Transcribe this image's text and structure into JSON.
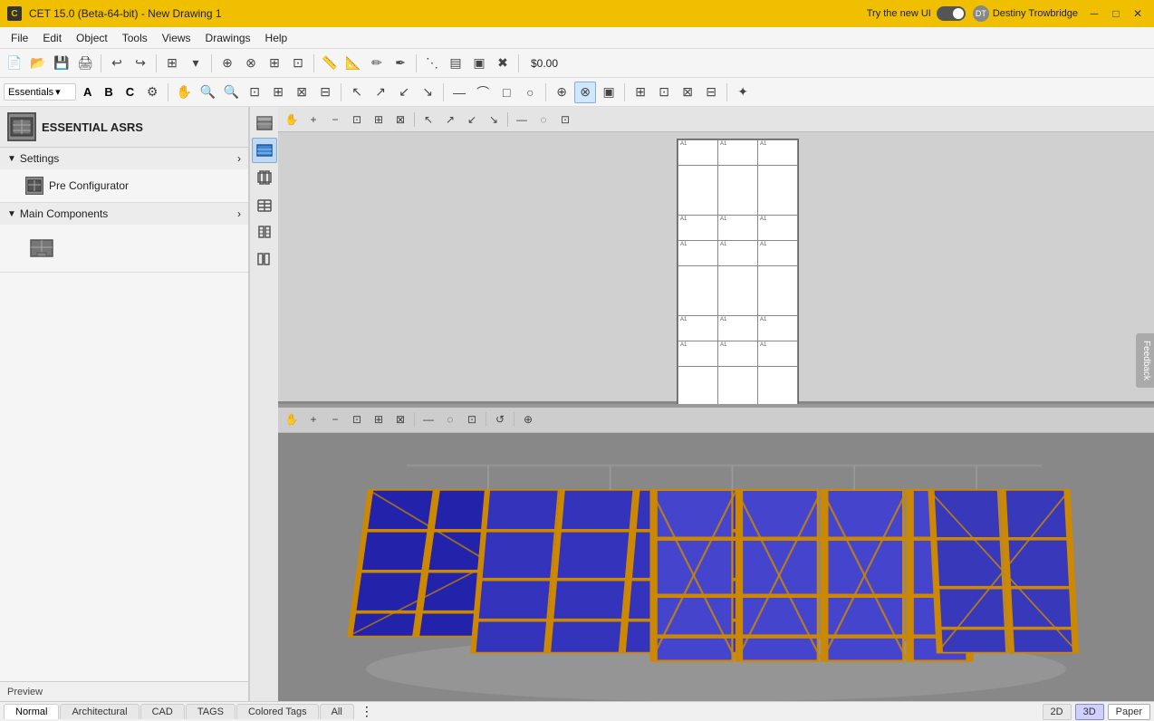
{
  "titleBar": {
    "appTitle": "CET 15.0 (Beta-64-bit) - New Drawing 1",
    "tryNewLabel": "Try the new UI",
    "userName": "Destiny Trowbridge",
    "winMinimize": "─",
    "winMaximize": "□",
    "winClose": "✕"
  },
  "menuBar": {
    "items": [
      "File",
      "Edit",
      "Object",
      "Tools",
      "Views",
      "Drawings",
      "Help"
    ]
  },
  "toolbar1": {
    "buttons": [
      "📋",
      "📂",
      "💾",
      "🖨",
      "|",
      "↩",
      "↪",
      "|",
      "⊞",
      "▾",
      "|"
    ],
    "price": "$0.00"
  },
  "workspaceTabs": {
    "tabs": [
      "A",
      "B",
      "C"
    ],
    "activeTab": "A",
    "dropdown": "Essentials",
    "settingsIcon": "⚙"
  },
  "sidebar": {
    "title": "ESSENTIAL ASRS",
    "sections": [
      {
        "name": "Settings",
        "expanded": true,
        "items": [
          {
            "label": "Pre Configurator"
          }
        ]
      },
      {
        "name": "Main Components",
        "expanded": true,
        "items": []
      }
    ]
  },
  "bottomTabs": {
    "tabs": [
      {
        "label": "Normal",
        "active": true
      },
      {
        "label": "Architectural",
        "active": false
      },
      {
        "label": "CAD",
        "active": false
      },
      {
        "label": "TAGS",
        "active": false
      },
      {
        "label": "Colored Tags",
        "active": false
      },
      {
        "label": "All",
        "active": false
      }
    ],
    "viewModes": [
      "2D",
      "3D",
      "Paper"
    ],
    "activeModes": [
      "3D",
      "Paper"
    ]
  },
  "preview": {
    "label": "Preview"
  },
  "feedback": {
    "label": "Feedback"
  },
  "colors": {
    "titleBarBg": "#f0c000",
    "rackColor": "#3333aa",
    "frameColor": "#cc8800",
    "groundColor": "#999999"
  }
}
